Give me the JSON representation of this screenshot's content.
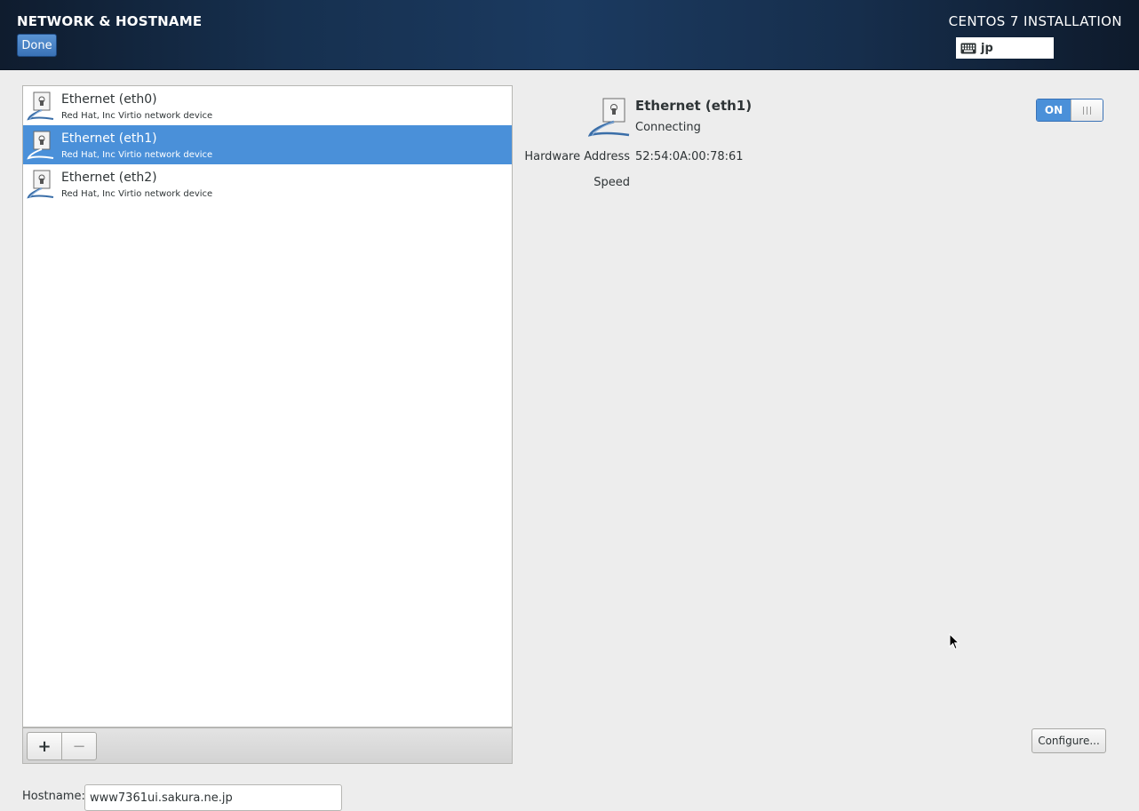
{
  "header": {
    "title": "NETWORK & HOSTNAME",
    "done_label": "Done",
    "product": "CENTOS 7 INSTALLATION",
    "keyboard_layout": "jp"
  },
  "devices": [
    {
      "name": "Ethernet (eth0)",
      "description": "Red Hat, Inc Virtio network device",
      "selected": false
    },
    {
      "name": "Ethernet (eth1)",
      "description": "Red Hat, Inc Virtio network device",
      "selected": true
    },
    {
      "name": "Ethernet (eth2)",
      "description": "Red Hat, Inc Virtio network device",
      "selected": false
    }
  ],
  "list_toolbar": {
    "add_label": "+",
    "remove_label": "−"
  },
  "detail": {
    "name": "Ethernet (eth1)",
    "status": "Connecting",
    "hardware_address_label": "Hardware Address",
    "hardware_address": "52:54:0A:00:78:61",
    "speed_label": "Speed",
    "speed": "",
    "toggle_label": "ON",
    "configure_label": "Configure..."
  },
  "hostname": {
    "label": "Hostname:",
    "value": "www7361ui.sakura.ne.jp"
  },
  "colors": {
    "header_bg": "#16304f",
    "accent": "#4a90d9",
    "background": "#ededed"
  },
  "icons": [
    "keyboard-icon",
    "ethernet-icon",
    "mouse-cursor-icon"
  ]
}
